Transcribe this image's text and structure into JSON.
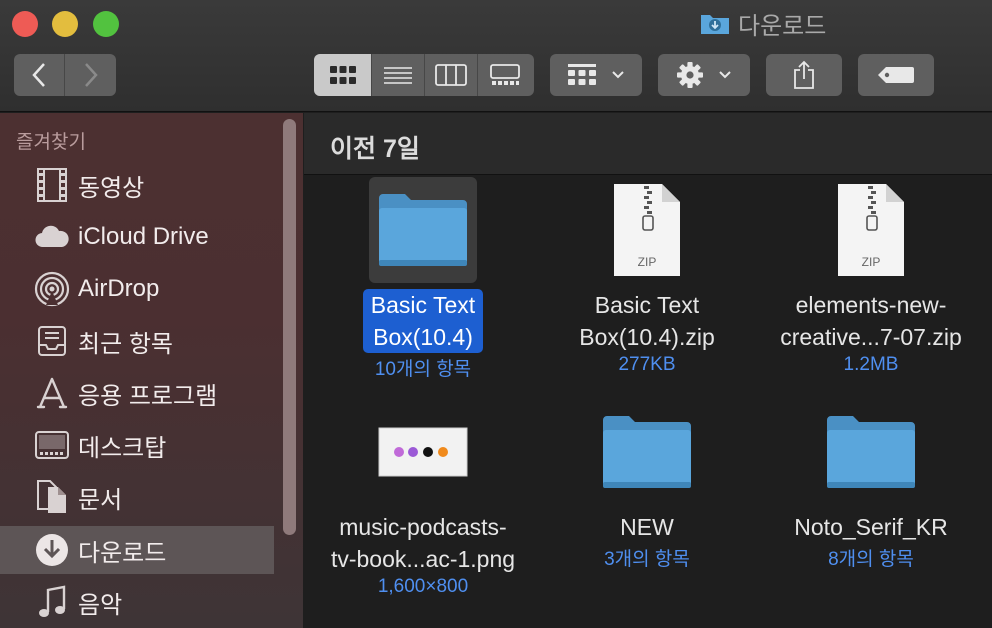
{
  "window": {
    "title": "다운로드"
  },
  "toolbar": {
    "back": "back",
    "forward": "forward",
    "views": [
      "icon-view",
      "list-view",
      "column-view",
      "gallery-view"
    ],
    "active_view": "icon-view"
  },
  "sidebar": {
    "header": "즐겨찾기",
    "items": [
      {
        "label": "동영상",
        "icon": "film-icon"
      },
      {
        "label": "iCloud Drive",
        "icon": "cloud-icon"
      },
      {
        "label": "AirDrop",
        "icon": "airdrop-icon"
      },
      {
        "label": "최근 항목",
        "icon": "recents-icon"
      },
      {
        "label": "응용 프로그램",
        "icon": "applications-icon"
      },
      {
        "label": "데스크탑",
        "icon": "desktop-icon"
      },
      {
        "label": "문서",
        "icon": "documents-icon"
      },
      {
        "label": "다운로드",
        "icon": "downloads-icon",
        "selected": true
      },
      {
        "label": "음악",
        "icon": "music-icon"
      }
    ]
  },
  "main": {
    "section_title": "이전 7일",
    "items": [
      {
        "line1": "Basic Text",
        "line2": "Box(10.4)",
        "meta": "10개의 항목",
        "type": "folder",
        "selected": true
      },
      {
        "line1": "Basic Text",
        "line2": "Box(10.4).zip",
        "meta": "277KB",
        "type": "zip",
        "zip_label": "ZIP"
      },
      {
        "line1": "elements-new-",
        "line2": "creative...7-07.zip",
        "meta": "1.2MB",
        "type": "zip",
        "zip_label": "ZIP"
      },
      {
        "line1": "music-podcasts-",
        "line2": "tv-book...ac-1.png",
        "meta": "1,600×800",
        "type": "image"
      },
      {
        "line1": "NEW",
        "line2": "",
        "meta": "3개의 항목",
        "type": "folder"
      },
      {
        "line1": "Noto_Serif_KR",
        "line2": "",
        "meta": "8개의 항목",
        "type": "folder"
      }
    ]
  },
  "colors": {
    "accent": "#1d5fd1",
    "meta_text": "#4f8ff0",
    "folder": "#5aa6dc"
  }
}
